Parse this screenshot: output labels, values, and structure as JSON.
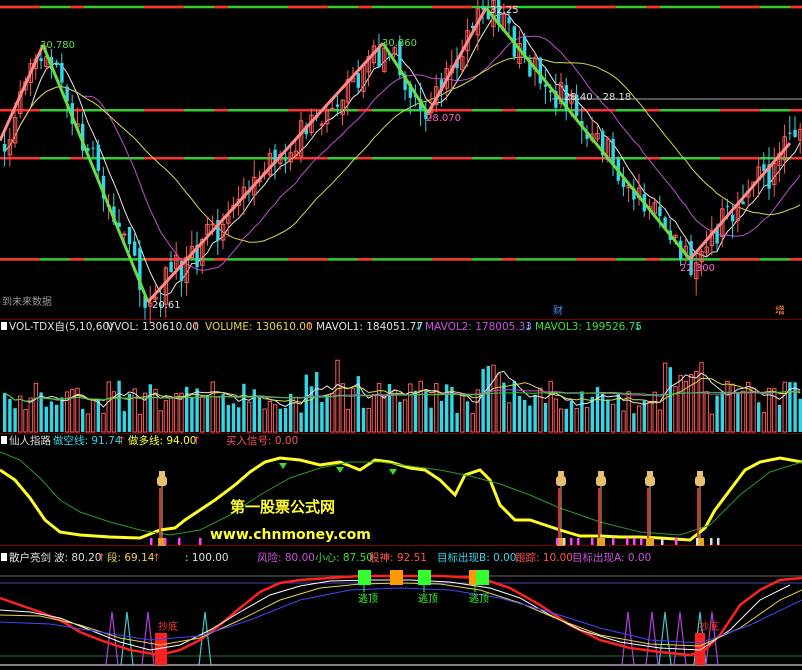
{
  "colors": {
    "background": "#000000",
    "up": "#ff5a5a",
    "down": "#33d6e6",
    "hline_green": "#33cc33",
    "hline_red": "#ff3030",
    "zig_up": "#ff8a8a",
    "zig_down": "#66dd44",
    "ma_white": "#e8e8e8",
    "ma_yellow": "#d8d84a",
    "ma_purple": "#c050d0",
    "xrx_yellow": "#ffff22",
    "xrx_green": "#2a9a2a",
    "lantern": "#e8c070",
    "pink": "#ff66cc",
    "magenta_bar": "#ff44ff",
    "ss_red": "#ff2020",
    "ss_white": "#ffffff",
    "ss_yellow": "#e8d44a",
    "ss_violet": "#b040e0",
    "ss_cyan": "#40c8d0",
    "escape_green": "#33ff33",
    "escape_orange": "#ff9900"
  },
  "main_panel": {
    "price_labels": {
      "peak1": "30.780",
      "peak2": "30.860",
      "peak3": "32.25",
      "trough1": "28.070",
      "trough2": "20.61",
      "trough3": "22.300",
      "range": "28.40 - 28.18"
    },
    "left_note": "到未来数据",
    "marker_cai": "财",
    "marker_zeng": "增"
  },
  "vol_panel": {
    "name": "VOL-TDX自(5,10,60)",
    "vvol": "VVOL: 130610.00",
    "vvol_arrow": "↑",
    "volume": "VOLUME: 130610.00",
    "volume_arrow": "↑",
    "mavol1": "MAVOL1: 184051.77",
    "mavol1_arrow": "↓",
    "mavol2": "MAVOL2: 178005.33",
    "mavol2_arrow": "↓",
    "mavol3": "MAVOL3: 199526.75",
    "mavol3_arrow": "↓"
  },
  "xrx_panel": {
    "name": "仙人指路",
    "kong": "做空线: 91.74",
    "kong_arrow": "↑",
    "duo": "做多线: 94.00",
    "duo_arrow": "↑",
    "buy": "买入信号: 0.00"
  },
  "ss_panel": {
    "name": "散户亮剑",
    "bo": "波: 80.20",
    "bo_arrow": "↑",
    "duan": "段: 69.14",
    "duan_arrow": "↑",
    "level": ": 100.00",
    "fengxian": "风险: 80.00",
    "xiaoxin": "小心: 87.50",
    "gushen": "股神: 92.51",
    "target_b": "目标出现B: 0.00",
    "genzong": "跟踪: 10.00",
    "target_a": "目标出现A: 0.00",
    "escape_label": "逃顶",
    "chaodi_label": "抄底"
  },
  "watermark": {
    "line1": "第一股票公式网",
    "line2": "www.chnmoney.com"
  },
  "chart_data": {
    "type": "candlestick",
    "price_min": 20.61,
    "price_max": 32.25,
    "horizontal_levels": [
      28.2,
      26.3,
      22.3
    ],
    "zigzag_points": [
      {
        "label": "30.780",
        "value": 30.78
      },
      {
        "label": "20.61",
        "value": 20.61
      },
      {
        "label": "30.860",
        "value": 30.86
      },
      {
        "label": "28.070",
        "value": 28.07
      },
      {
        "label": "32.25",
        "value": 32.25
      },
      {
        "label": "22.300",
        "value": 22.3
      }
    ],
    "volume_series": [
      "VOLUME",
      "MAVOL1",
      "MAVOL2",
      "MAVOL3"
    ],
    "indicator_series": [
      "做空线",
      "做多线"
    ]
  }
}
